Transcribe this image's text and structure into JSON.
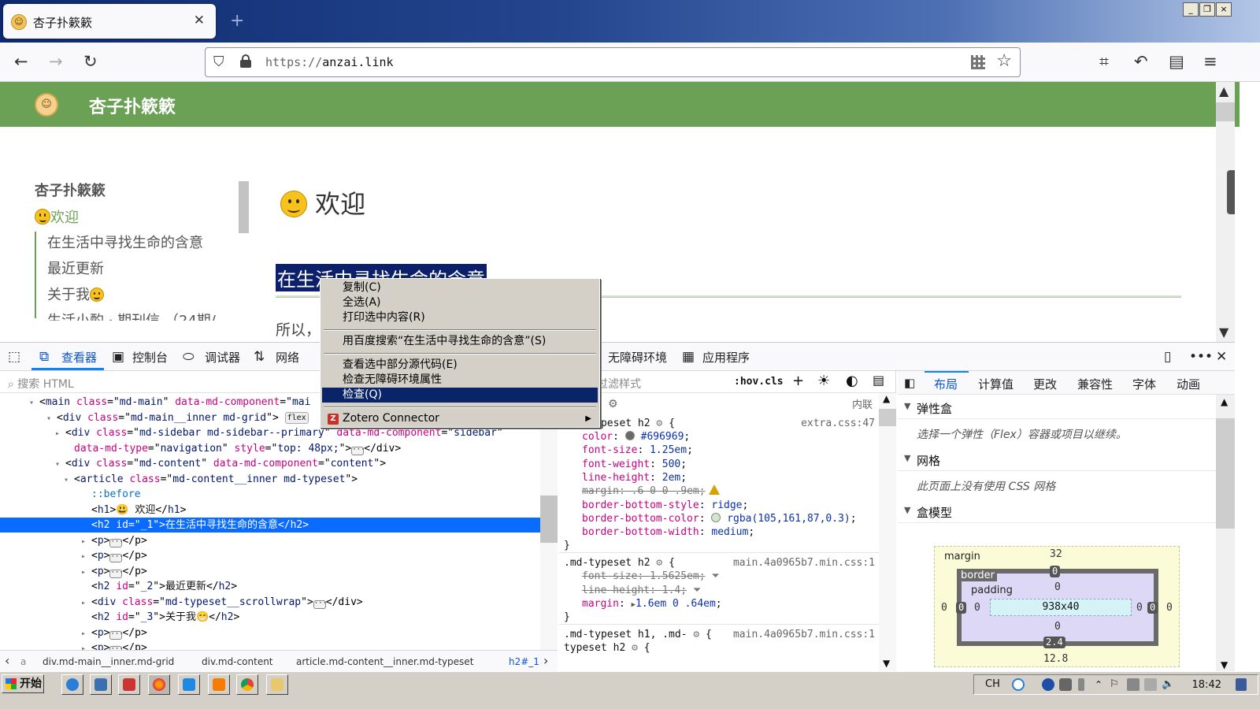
{
  "browser": {
    "tab_title": "杏子扑簌簌",
    "tab_favicon": "apricot-logo-icon",
    "new_tab_symbol": "+",
    "url_scheme": "https://",
    "url_host": "anzai.link",
    "window_buttons": [
      "_",
      "❐",
      "×"
    ]
  },
  "site": {
    "header_name": "杏子扑簌簌",
    "accent_color": "#6aa154",
    "sidebar": {
      "title": "杏子扑簌簌",
      "active": "欢迎",
      "items": [
        "在生活中寻找生命的含意",
        "最近更新",
        "关于我",
        "生活小酌 · 期刊信   （24期/"
      ]
    },
    "h1": "欢迎",
    "h2": "在生活中寻找生命的含意",
    "para": "所以，"
  },
  "devtools": {
    "tabs": [
      "查看器",
      "控制台",
      "调试器",
      "网络",
      "无障碍环境",
      "应用程序"
    ],
    "html_search_placeholder": "搜索 HTML",
    "css_filter_placeholder": "过滤样式",
    "hov_cls": ":hov.cls",
    "inline_label": "内联",
    "html_lines": [
      {
        "indent": 4,
        "twisty": "▾",
        "parts": [
          [
            "tag",
            "<"
          ],
          [
            "tn",
            "main"
          ],
          [
            "sp",
            " "
          ],
          [
            "an",
            "class"
          ],
          [
            "tag",
            "=\""
          ],
          [
            "av",
            "md-main"
          ],
          [
            "tag",
            "\" "
          ],
          [
            "an",
            "data-md-component"
          ],
          [
            "tag",
            "=\""
          ],
          [
            "av",
            "mai"
          ]
        ]
      },
      {
        "indent": 6,
        "twisty": "▾",
        "parts": [
          [
            "tag",
            "<"
          ],
          [
            "tn",
            "div"
          ],
          [
            "sp",
            " "
          ],
          [
            "an",
            "class"
          ],
          [
            "tag",
            "=\""
          ],
          [
            "av",
            "md-main__inner md-grid"
          ],
          [
            "tag",
            "\">"
          ]
        ],
        "badge": "flex"
      },
      {
        "indent": 7,
        "twisty": "▸",
        "parts": [
          [
            "tag",
            "<"
          ],
          [
            "tn",
            "div"
          ],
          [
            "sp",
            " "
          ],
          [
            "an",
            "class"
          ],
          [
            "tag",
            "=\""
          ],
          [
            "av",
            "md-sidebar md-sidebar--primary"
          ],
          [
            "tag",
            "\" "
          ],
          [
            "an",
            "data-md-component"
          ],
          [
            "tag",
            "=\""
          ],
          [
            "av",
            "sidebar"
          ],
          [
            "tag",
            "\""
          ]
        ]
      },
      {
        "indent": 8,
        "twisty": "",
        "parts": [
          [
            "an",
            "data-md-type"
          ],
          [
            "tag",
            "=\""
          ],
          [
            "av",
            "navigation"
          ],
          [
            "tag",
            "\" "
          ],
          [
            "an",
            "style"
          ],
          [
            "tag",
            "=\""
          ],
          [
            "av",
            "top: 48px;"
          ],
          [
            "tag",
            "\">"
          ]
        ],
        "ellipsis": true,
        "tail": "</div>"
      },
      {
        "indent": 7,
        "twisty": "▾",
        "parts": [
          [
            "tag",
            "<"
          ],
          [
            "tn",
            "div"
          ],
          [
            "sp",
            " "
          ],
          [
            "an",
            "class"
          ],
          [
            "tag",
            "=\""
          ],
          [
            "av",
            "md-content"
          ],
          [
            "tag",
            "\" "
          ],
          [
            "an",
            "data-md-component"
          ],
          [
            "tag",
            "=\""
          ],
          [
            "av",
            "content"
          ],
          [
            "tag",
            "\">"
          ]
        ]
      },
      {
        "indent": 8,
        "twisty": "▾",
        "parts": [
          [
            "tag",
            "<"
          ],
          [
            "tn",
            "article"
          ],
          [
            "sp",
            " "
          ],
          [
            "an",
            "class"
          ],
          [
            "tag",
            "=\""
          ],
          [
            "av",
            "md-content__inner md-typeset"
          ],
          [
            "tag",
            "\">"
          ]
        ]
      },
      {
        "indent": 10,
        "twisty": "",
        "parts": [
          [
            "pseudo",
            "::before"
          ]
        ]
      },
      {
        "indent": 10,
        "twisty": "",
        "parts": [
          [
            "tag",
            "<"
          ],
          [
            "tn",
            "h1"
          ],
          [
            "tag",
            ">"
          ],
          [
            "txt",
            "😃 欢迎"
          ],
          [
            "tag",
            "</"
          ],
          [
            "tn",
            "h1"
          ],
          [
            "tag",
            ">"
          ]
        ]
      },
      {
        "indent": 10,
        "twisty": "",
        "selected": true,
        "parts": [
          [
            "tag",
            "<"
          ],
          [
            "tn",
            "h2"
          ],
          [
            "sp",
            " "
          ],
          [
            "an",
            "id"
          ],
          [
            "tag",
            "=\""
          ],
          [
            "av",
            "_1"
          ],
          [
            "tag",
            "\">"
          ],
          [
            "txt",
            "在生活中寻找生命的含意"
          ],
          [
            "tag",
            "</"
          ],
          [
            "tn",
            "h2"
          ],
          [
            "tag",
            ">"
          ]
        ]
      },
      {
        "indent": 10,
        "twisty": "▸",
        "parts": [
          [
            "tag",
            "<"
          ],
          [
            "tn",
            "p"
          ],
          [
            "tag",
            ">"
          ]
        ],
        "ellipsis": true,
        "tail": "</p>"
      },
      {
        "indent": 10,
        "twisty": "▸",
        "parts": [
          [
            "tag",
            "<"
          ],
          [
            "tn",
            "p"
          ],
          [
            "tag",
            ">"
          ]
        ],
        "ellipsis": true,
        "tail": "</p>"
      },
      {
        "indent": 10,
        "twisty": "▸",
        "parts": [
          [
            "tag",
            "<"
          ],
          [
            "tn",
            "p"
          ],
          [
            "tag",
            ">"
          ]
        ],
        "ellipsis": true,
        "tail": "</p>"
      },
      {
        "indent": 10,
        "twisty": "",
        "parts": [
          [
            "tag",
            "<"
          ],
          [
            "tn",
            "h2"
          ],
          [
            "sp",
            " "
          ],
          [
            "an",
            "id"
          ],
          [
            "tag",
            "=\""
          ],
          [
            "av",
            "_2"
          ],
          [
            "tag",
            "\">"
          ],
          [
            "txt",
            "最近更新"
          ],
          [
            "tag",
            "</"
          ],
          [
            "tn",
            "h2"
          ],
          [
            "tag",
            ">"
          ]
        ]
      },
      {
        "indent": 10,
        "twisty": "▸",
        "parts": [
          [
            "tag",
            "<"
          ],
          [
            "tn",
            "div"
          ],
          [
            "sp",
            " "
          ],
          [
            "an",
            "class"
          ],
          [
            "tag",
            "=\""
          ],
          [
            "av",
            "md-typeset__scrollwrap"
          ],
          [
            "tag",
            "\">"
          ]
        ],
        "ellipsis": true,
        "tail": "</div>"
      },
      {
        "indent": 10,
        "twisty": "",
        "parts": [
          [
            "tag",
            "<"
          ],
          [
            "tn",
            "h2"
          ],
          [
            "sp",
            " "
          ],
          [
            "an",
            "id"
          ],
          [
            "tag",
            "=\""
          ],
          [
            "av",
            "_3"
          ],
          [
            "tag",
            "\">"
          ],
          [
            "txt",
            "关于我😁"
          ],
          [
            "tag",
            "</"
          ],
          [
            "tn",
            "h2"
          ],
          [
            "tag",
            ">"
          ]
        ]
      },
      {
        "indent": 10,
        "twisty": "▸",
        "parts": [
          [
            "tag",
            "<"
          ],
          [
            "tn",
            "p"
          ],
          [
            "tag",
            ">"
          ]
        ],
        "ellipsis": true,
        "tail": "</p>"
      },
      {
        "indent": 10,
        "twisty": "▸",
        "parts": [
          [
            "tag",
            "<"
          ],
          [
            "tn",
            "p"
          ],
          [
            "tag",
            ">"
          ]
        ],
        "ellipsis": true,
        "tail": "</p>"
      }
    ],
    "breadcrumbs": [
      "a",
      "div.md-main__inner.md-grid",
      "div.md-content",
      "article.md-content__inner.md-typeset",
      "h2#_1"
    ],
    "rules": [
      {
        "selector": ".md-typeset h2",
        "source": "extra.css:47",
        "decls": [
          {
            "name": "color",
            "value": "#696969",
            "swatch": "#696969"
          },
          {
            "name": "font-size",
            "value": "1.25em"
          },
          {
            "name": "font-weight",
            "value": "500"
          },
          {
            "name": "line-height",
            "value": "2em"
          },
          {
            "name": "margin",
            "value": ".6 0 0 .9em",
            "struck": true,
            "warn": true
          },
          {
            "name": "border-bottom-style",
            "value": "ridge"
          },
          {
            "name": "border-bottom-color",
            "value": "rgba(105,161,87,0.3)",
            "swatch": "#d3e6cc"
          },
          {
            "name": "border-bottom-width",
            "value": "medium"
          }
        ]
      },
      {
        "selector": ".md-typeset h2",
        "source": "main.4a0965b7.min.css:1",
        "decls": [
          {
            "name": "font-size",
            "value": "1.5625em",
            "struck": true,
            "filter": true
          },
          {
            "name": "line-height",
            "value": "1.4",
            "struck": true,
            "filter": true
          },
          {
            "name": "margin",
            "value": "1.6em 0 .64em",
            "expander": true
          }
        ]
      },
      {
        "selector": ".md-typeset h1, .md-",
        "selector2": "typeset h2",
        "source": "main.4a0965b7.min.css:1",
        "decls": []
      }
    ],
    "layout_tabs": [
      "布局",
      "计算值",
      "更改",
      "兼容性",
      "字体",
      "动画"
    ],
    "flexbox_title": "弹性盒",
    "flexbox_msg": "选择一个弹性（Flex）容器或项目以继续。",
    "grid_title": "网格",
    "grid_msg": "此页面上没有使用 CSS 网格",
    "boxmodel_title": "盒模型",
    "boxmodel": {
      "margin_label": "margin",
      "border_label": "border",
      "padding_label": "padding",
      "margin_top": "32",
      "margin_right": "0",
      "margin_bottom": "12.8",
      "margin_left": "0",
      "border_top": "0",
      "border_right": "0",
      "border_bottom": "2.4",
      "border_left": "0",
      "padding_top": "0",
      "padding_right": "0",
      "padding_bottom": "0",
      "padding_left": "0",
      "content": "938x40"
    }
  },
  "context_menu": {
    "items": [
      {
        "label": "复制(C)"
      },
      {
        "label": "全选(A)"
      },
      {
        "label": "打印选中内容(R)"
      },
      {
        "sep": true
      },
      {
        "label": "用百度搜索“在生活中寻找生命的含意”(S)"
      },
      {
        "sep": true
      },
      {
        "label": "查看选中部分源代码(E)"
      },
      {
        "label": "检查无障碍环境属性"
      },
      {
        "label": "检查(Q)",
        "highlight": true
      },
      {
        "sep": true
      },
      {
        "label": "Zotero Connector",
        "submenu": true
      }
    ]
  },
  "taskbar": {
    "start_label": "开始",
    "lang": "CH",
    "clock": "18:42"
  }
}
